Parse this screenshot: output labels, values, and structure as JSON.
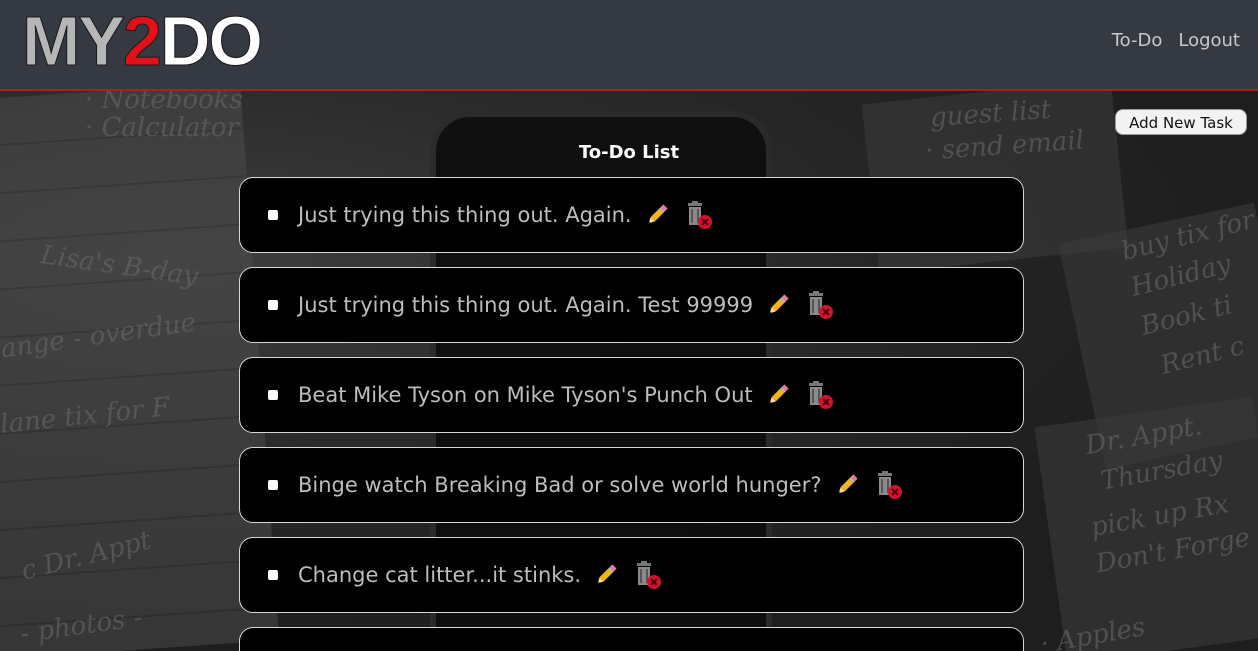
{
  "header": {
    "logo": {
      "part1": "MY",
      "part2": "2",
      "part3": "DO"
    },
    "nav": [
      {
        "label": "To-Do"
      },
      {
        "label": "Logout"
      }
    ]
  },
  "actions": {
    "add_task_label": "Add New Task"
  },
  "list": {
    "title": "To-Do List",
    "tasks": [
      {
        "text": "Just trying this thing out. Again."
      },
      {
        "text": "Just trying this thing out. Again. Test 99999"
      },
      {
        "text": "Beat Mike Tyson on Mike Tyson's Punch Out"
      },
      {
        "text": "Binge watch Breaking Bad or solve world hunger?"
      },
      {
        "text": "Change cat litter...it stinks."
      },
      {
        "text": ""
      }
    ]
  },
  "background_scribbles": {
    "a": "· Notebooks",
    "b": "· Calculator",
    "c": "Lisa's B-day",
    "d": "ange - overdue",
    "e": "lane tix for F",
    "f": "c Dr. Appt",
    "g": "- photos -",
    "h": "guest list",
    "i": "· send email",
    "j": "buy tix for",
    "k": "Holiday",
    "l": "Book ti",
    "m": "Rent c",
    "n": "Dr. Appt.",
    "o": "Thursday",
    "p": "pick up Rx",
    "q": "Don't Forge",
    "r": "· Apples"
  },
  "colors": {
    "header_bg": "#343942",
    "accent_red": "#c0161b",
    "task_bg": "#000000",
    "task_border": "#d7d7d7"
  }
}
